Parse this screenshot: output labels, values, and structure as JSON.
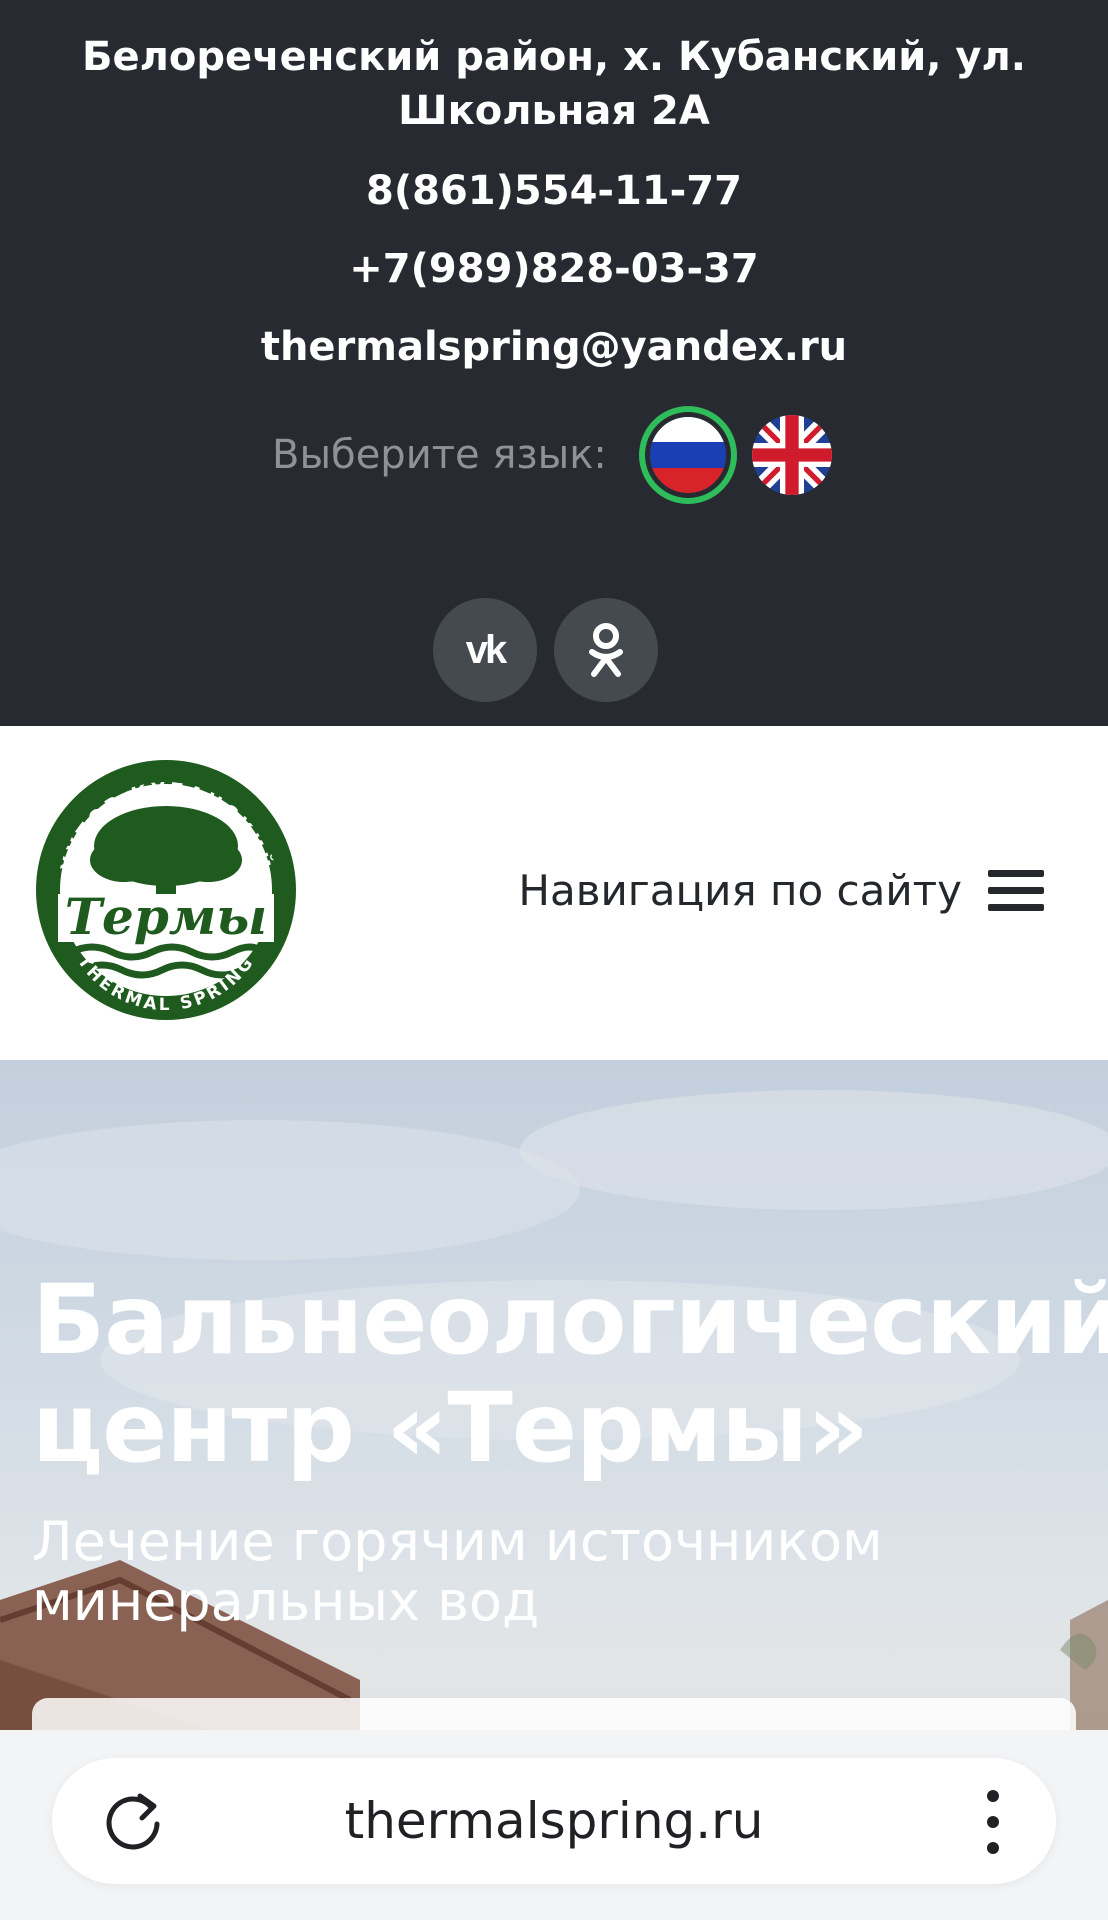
{
  "topbar": {
    "address": "Белореченский район, х. Кубанский, ул. Школьная 2А",
    "phone1": "8(861)554-11-77",
    "phone2": "+7(989)828-03-37",
    "email": "thermalspring@yandex.ru",
    "language_label": "Выберите язык:",
    "languages": [
      {
        "icon": "russia-flag-icon",
        "selected": true
      },
      {
        "icon": "uk-flag-icon",
        "selected": false
      }
    ],
    "socials": [
      {
        "icon": "vk-icon",
        "text": "vk"
      },
      {
        "icon": "odnoklassniki-icon"
      }
    ],
    "colors": {
      "background": "#272b31",
      "selected_ring": "#2ebd5a",
      "social_button": "#454a50"
    }
  },
  "header": {
    "logo": {
      "top_text": "ХУТОР КУБАНСКИЙ",
      "main_text": "Термы",
      "bottom_text": "THERMAL SPRING",
      "color": "#1f5a1f"
    },
    "nav_label": "Навигация по сайту",
    "nav_icon": "hamburger-menu-icon"
  },
  "hero": {
    "title": "Бальнеологический центр «Термы»",
    "subtitle": "Лечение горячим источником минеральных вод"
  },
  "browser": {
    "url": "thermalspring.ru",
    "reload_icon": "reload-icon",
    "menu_icon": "more-vertical-icon"
  }
}
